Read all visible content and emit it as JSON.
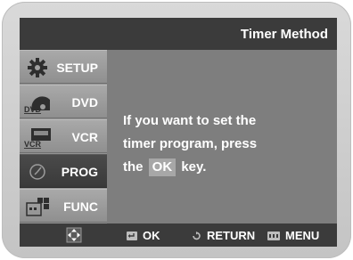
{
  "header": {
    "title": "Timer Method"
  },
  "sidebar": {
    "items": [
      {
        "label": "SETUP",
        "icon": "gear-icon",
        "active": false
      },
      {
        "label": "DVD",
        "icon": "dvd-disc-icon",
        "active": false,
        "icon_text": "DVD"
      },
      {
        "label": "VCR",
        "icon": "vcr-cassette-icon",
        "active": false,
        "icon_text": "VCR"
      },
      {
        "label": "PROG",
        "icon": "clock-icon",
        "active": true
      },
      {
        "label": "FUNC",
        "icon": "function-grid-icon",
        "active": false
      }
    ]
  },
  "message": {
    "line1": "If you want to set the",
    "line2": "timer program, press",
    "line3_prefix": "the",
    "key": "OK",
    "line3_suffix": "key."
  },
  "footer": {
    "nav_icon": "direction-pad-icon",
    "hints": [
      {
        "label": "OK",
        "icon": "enter-icon"
      },
      {
        "label": "RETURN",
        "icon": "return-icon"
      },
      {
        "label": "MENU",
        "icon": "menu-icon"
      }
    ]
  },
  "colors": {
    "title_bar": "#3b3b3b",
    "screen_bg": "#7e7e7e",
    "active_item": "#3f3f3f",
    "text": "#ffffff"
  }
}
